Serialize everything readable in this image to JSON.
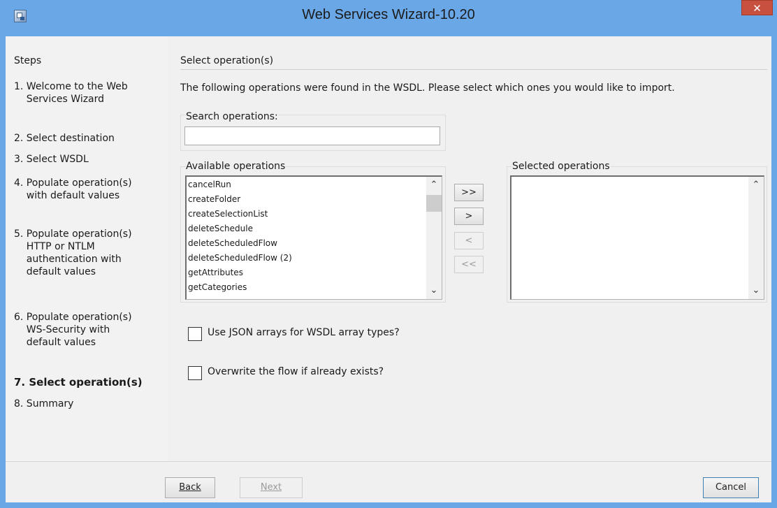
{
  "window": {
    "title": "Web Services Wizard-10.20",
    "close_label": "✕"
  },
  "steps": {
    "heading": "Steps",
    "items": [
      {
        "label": "1. Welcome to the Web\n    Services Wizard",
        "active": false
      },
      {
        "label": "2. Select destination",
        "active": false
      },
      {
        "label": "3. Select WSDL",
        "active": false
      },
      {
        "label": "4. Populate operation(s)\n    with default values",
        "active": false
      },
      {
        "label": "5. Populate operation(s)\n    HTTP or NTLM\n    authentication with\n    default values",
        "active": false
      },
      {
        "label": "6. Populate operation(s)\n    WS-Security with\n    default values",
        "active": false
      },
      {
        "label": "7. Select operation(s)",
        "active": true
      },
      {
        "label": "8. Summary",
        "active": false
      }
    ]
  },
  "main": {
    "section_title": "Select operation(s)",
    "description": "The following operations were found in the WSDL. Please select which ones you would like to import.",
    "search": {
      "label": "Search operations:",
      "value": "",
      "placeholder": ""
    },
    "available": {
      "label": "Available operations",
      "items": [
        "cancelRun",
        "createFolder",
        "createSelectionList",
        "deleteSchedule",
        "deleteScheduledFlow",
        "deleteScheduledFlow (2)",
        "getAttributes",
        "getCategories"
      ]
    },
    "selected": {
      "label": "Selected operations",
      "items": []
    },
    "transfer_buttons": {
      "add_all": ">>",
      "add": ">",
      "remove": "<",
      "remove_all": "<<"
    },
    "options": {
      "json_arrays_label": "Use JSON arrays for WSDL array types?",
      "json_arrays_checked": false,
      "overwrite_label": "Overwrite the flow if already exists?",
      "overwrite_checked": false
    }
  },
  "footer": {
    "back_label": "Back",
    "next_label": "Next",
    "cancel_label": "Cancel"
  },
  "colors": {
    "titlebar": "#6aa7e6",
    "close_button": "#c7503e",
    "panel": "#f0f0f0"
  }
}
